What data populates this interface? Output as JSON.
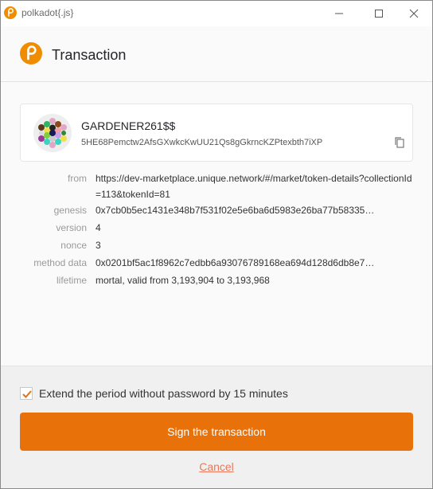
{
  "window": {
    "title": "polkadot{.js}",
    "icon": "polkadot-logo-icon",
    "controls": [
      "minimize-icon",
      "maximize-icon",
      "close-icon"
    ]
  },
  "header": {
    "title": "Transaction",
    "logo": "polkadot-logo-icon"
  },
  "account": {
    "name": "GARDENER261$$",
    "address": "5HE68Pemctw2AfsGXwkcKwUU21Qs8gGkrncKZPtexbth7iXP",
    "copy_icon": "copy-icon"
  },
  "details": {
    "from_label": "from",
    "from_value": "https://dev-marketplace.unique.network/#/market/token-details?collectionId=113&tokenId=81",
    "genesis_label": "genesis",
    "genesis_value": "0x7cb0b5ec1431e348b7f531f02e5e6ba6d5983e26ba77b58335…",
    "version_label": "version",
    "version_value": "4",
    "nonce_label": "nonce",
    "nonce_value": "3",
    "method_label": "method data",
    "method_value": "0x0201bf5ac1f8962c7edbb6a93076789168ea694d128d6db8e7…",
    "lifetime_label": "lifetime",
    "lifetime_value": "mortal, valid from 3,193,904 to 3,193,968"
  },
  "footer": {
    "checkbox_label": "Extend the period without password by 15 minutes",
    "checkbox_checked": true,
    "sign_label": "Sign the transaction",
    "cancel_label": "Cancel"
  },
  "colors": {
    "accent": "#e8710a",
    "logo": "#f08c00",
    "cancel": "#e9795a"
  }
}
